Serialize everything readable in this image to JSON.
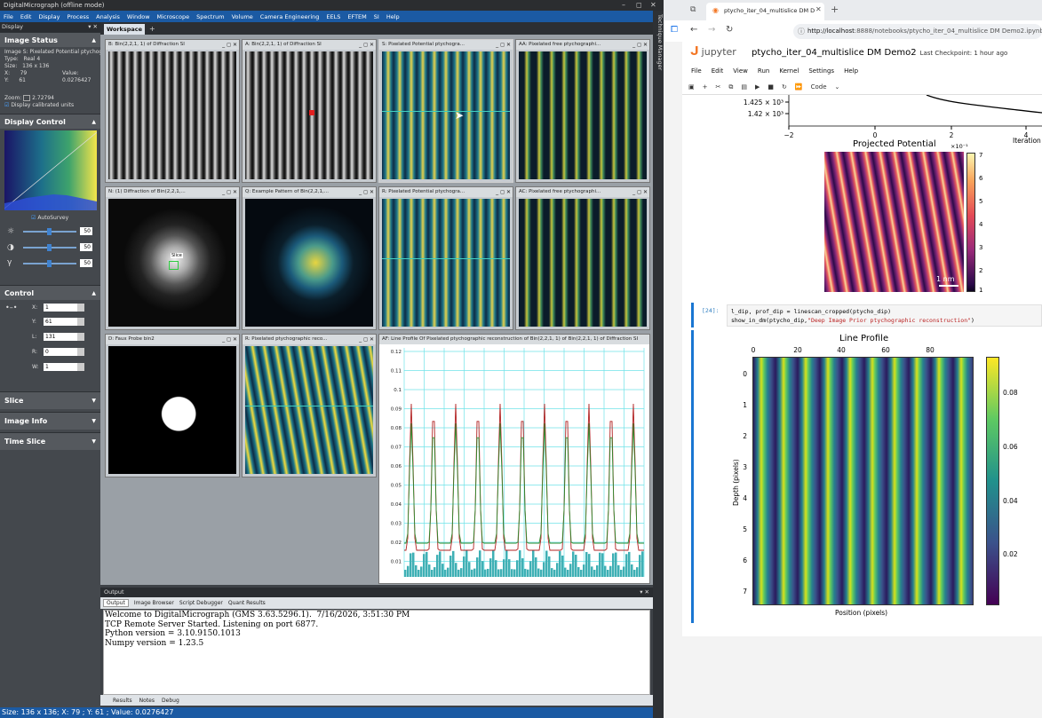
{
  "dm": {
    "title": "DigitalMicrograph (offline mode)",
    "menu": [
      "File",
      "Edit",
      "Display",
      "Process",
      "Analysis",
      "Window",
      "Microscope",
      "Spectrum",
      "Volume",
      "Camera Engineering",
      "EELS",
      "EFTEM",
      "SI",
      "Help"
    ],
    "technique_manager": "Technique Manager",
    "panel_header": "Display",
    "image_status": {
      "header": "Image Status",
      "image_name": "Image S: Pixelated Potential ptychograp",
      "type_label": "Type:",
      "type_value": "Real 4",
      "size_label": "Size:",
      "size_value": "136 x 136",
      "x_label": "X:",
      "x_value": "79",
      "value_label": "Value:",
      "y_label": "Y:",
      "y_value": "61",
      "value_value": "0.0276427",
      "zoom_label": "Zoom:",
      "zoom_value": "2.72794",
      "calibrated_label": "Display calibrated units"
    },
    "display_control": {
      "header": "Display Control",
      "autosurvey": "AutoSurvey",
      "brightness": "50",
      "contrast": "50",
      "gamma": "50"
    },
    "control": {
      "header": "Control",
      "x_label": "X:",
      "x_value": "1",
      "y_label": "Y:",
      "y_value": "61",
      "l_label": "L:",
      "l_value": "131",
      "r_label": "R:",
      "r_value": "0",
      "w_label": "W:",
      "w_value": "1"
    },
    "collapsed": [
      "Slice",
      "Image Info",
      "Time Slice"
    ],
    "workspace_tab": "Workspace 1",
    "workspace_add": "+",
    "windows": [
      {
        "title": "B: Bin(2,2,1, 1) of Diffraction SI"
      },
      {
        "title": "A: Bin(2,2,1, 1) of Diffraction SI"
      },
      {
        "title": "S: Pixelated Potential ptychogra..."
      },
      {
        "title": "AA: Pixelated free ptychographi..."
      },
      {
        "title": "N: (1) Diffraction of Bin(2,2,1,..."
      },
      {
        "title": "Q: Example Pattern of Bin(2,2,1,..."
      },
      {
        "title": "R: Pixelated Potential ptychogra..."
      },
      {
        "title": "AC: Pixelated free ptychographi..."
      },
      {
        "title": "D: Faux Probe bin2"
      },
      {
        "title": "R: Pixelated ptychographic reco..."
      },
      {
        "title": "AF: Line Profile Of Pixelated ptychographic reconstruction of Bin(2,2,1, 1) of Bin(2,2,1, 1) of Diffraction SI"
      }
    ],
    "window_controls": "_ ◻ ✕",
    "slice_label": "Slice",
    "line_profile_yticks": [
      "0.12",
      "0.11",
      "0.1",
      "0.09",
      "0.08",
      "0.07",
      "0.06",
      "0.05",
      "0.04",
      "0.03",
      "0.02",
      "0.01"
    ],
    "output": {
      "header": "Output",
      "tabs": [
        "Output",
        "Image Browser",
        "Script Debugger",
        "Quant Results"
      ],
      "lines": [
        "Welcome to DigitalMicrograph (GMS 3.63.5296.1).  7/16/2026, 3:51:30 PM",
        "TCP Remote Server Started. Listening on port 6877.",
        "Python version = 3.10.9150.1013",
        "Numpy version = 1.23.5"
      ],
      "bottom_tabs": [
        "Results",
        "Notes",
        "Debug"
      ]
    },
    "status": "Size: 136 x 136;  X: 79 ;  Y: 61 ;  Value: 0.0276427"
  },
  "browser": {
    "tab_title": "ptycho_iter_04_multislice DM D",
    "new_tab": "+",
    "url_host": "http://localhost",
    "url_rest": ":8888/notebooks/ptycho_iter_04_multislice DM Demo2.ipynb",
    "jupyter": {
      "logo": "jupyter",
      "notebook_title": "ptycho_iter_04_multislice DM Demo2",
      "checkpoint": "Last Checkpoint: 1 hour ago",
      "menu": [
        "File",
        "Edit",
        "View",
        "Run",
        "Kernel",
        "Settings",
        "Help"
      ],
      "cell_type": "Code",
      "top_plot": {
        "yticks": [
          "1.425 × 10³",
          "1.42 × 10³"
        ],
        "xticks": [
          "−2",
          "0",
          "2",
          "4"
        ],
        "xlabel": "Iteration"
      },
      "projected_potential": {
        "title": "Projected Potential",
        "exp": "×10⁻¹",
        "colorbar_ticks": [
          "7",
          "6",
          "5",
          "4",
          "3",
          "2",
          "1"
        ],
        "scalebar": "1 nm"
      },
      "cell_prompt": "[24]:",
      "code_line1": "l_dip, prof_dip = linescan_cropped(ptycho_dip)",
      "code_line2_a": "show_in_dm(ptycho_dip,",
      "code_line2_b": "\"Deep Image Prior ptychographic reconstruction\"",
      "code_line2_c": ")",
      "line_profile_plot": {
        "title": "Line Profile",
        "xticks": [
          "0",
          "20",
          "40",
          "60",
          "80"
        ],
        "yticks": [
          "0",
          "1",
          "2",
          "3",
          "4",
          "5",
          "6",
          "7"
        ],
        "xlabel": "Position (pixels)",
        "ylabel": "Depth (pixels)",
        "colorbar_ticks": [
          "0.08",
          "0.06",
          "0.04",
          "0.02"
        ]
      }
    }
  },
  "colors": {
    "dm_menu": "#1b5aa3",
    "accent_orange": "#f37726",
    "cell_bar": "#1976d2"
  }
}
